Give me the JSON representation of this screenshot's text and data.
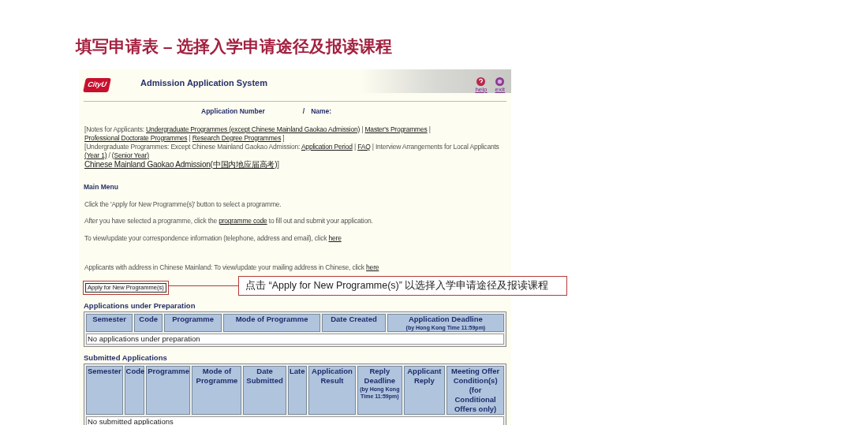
{
  "heading": "填写申请表 – 选择入学申请途径及报读课程",
  "app": {
    "logo": "CityU",
    "title": "Admission Application System",
    "header_links": [
      {
        "kind": "help",
        "label": "help"
      },
      {
        "kind": "exit",
        "label": "exit"
      }
    ]
  },
  "application_line": {
    "number_label": "Application Number",
    "separator": "/",
    "name_label": "Name:"
  },
  "notes": [
    [
      {
        "text": "[Notes for Applicants: ",
        "link": false
      },
      {
        "text": "Undergraduate Programmes (except Chinese Mainland Gaokao Admission)",
        "link": true
      },
      {
        "text": " | ",
        "link": false
      },
      {
        "text": "Master's Programmes",
        "link": true
      },
      {
        "text": " | ",
        "link": false
      },
      {
        "text": "Professional Doctorate Programmes",
        "link": true
      },
      {
        "text": " | ",
        "link": false
      },
      {
        "text": "Research Degree Programmes",
        "link": true
      },
      {
        "text": " ]",
        "link": false
      }
    ],
    [
      {
        "text": "[Undergraduate Programmes: Except Chinese Mainland Gaokao Admission: ",
        "link": false
      },
      {
        "text": "Application Period",
        "link": true
      },
      {
        "text": " | ",
        "link": false
      },
      {
        "text": "FAQ",
        "link": true
      },
      {
        "text": " | Interview Arrangements for Local Applicants ",
        "link": false
      },
      {
        "text": "(Year 1)",
        "link": true
      },
      {
        "text": " / ",
        "link": false
      },
      {
        "text": "(Senior Year)",
        "link": true
      }
    ],
    [
      {
        "text": "Chinese Mainland Gaokao Admission(中国内地应届高考)",
        "link": true
      },
      {
        "text": "]",
        "link": false
      }
    ]
  ],
  "main_menu": {
    "title": "Main Menu",
    "lines": [
      [
        {
          "text": "Click the 'Apply for New Programme(s)' button to select a programme.",
          "link": false
        }
      ],
      [
        {
          "text": "After you have selected a programme, click the ",
          "link": false
        },
        {
          "text": "programme code",
          "link": true
        },
        {
          "text": " to fill out and submit your application.",
          "link": false
        }
      ],
      [
        {
          "text": "To view/update your correspondence information (telephone, address and email), click ",
          "link": false
        },
        {
          "text": "here",
          "link": true
        }
      ],
      [
        {
          "text": "Applicants with address in Chinese Mainland: To view/update your mailing address in Chinese, click ",
          "link": false
        },
        {
          "text": "here",
          "link": true
        }
      ]
    ]
  },
  "apply_button": "Apply for New Programme(s)",
  "callout": "点击 “Apply for New Programme(s)” 以选择入学申请途径及报读课程",
  "tables": [
    {
      "title": "Applications under Preparation",
      "columns": [
        {
          "label": "Semester"
        },
        {
          "label": "Code"
        },
        {
          "label": "Programme"
        },
        {
          "label": "Mode of Programme"
        },
        {
          "label": "Date Created"
        },
        {
          "label": "Application Deadline",
          "note": "(by Hong Kong Time 11:59pm)"
        }
      ],
      "empty_text": "No applications under preparation"
    },
    {
      "title": "Submitted Applications",
      "columns": [
        {
          "label": "Semester"
        },
        {
          "label": "Code"
        },
        {
          "label": "Programme"
        },
        {
          "label": "Mode of Programme"
        },
        {
          "label": "Date Submitted"
        },
        {
          "label": "Late"
        },
        {
          "label": "Application Result"
        },
        {
          "label": "Reply Deadline",
          "note": "(by Hong Kong Time 11:59pm)"
        },
        {
          "label": "Applicant Reply"
        },
        {
          "label": "Meeting Offer Condition(s) (for Conditional Offers only)"
        }
      ],
      "empty_text": "No submitted applications"
    }
  ]
}
